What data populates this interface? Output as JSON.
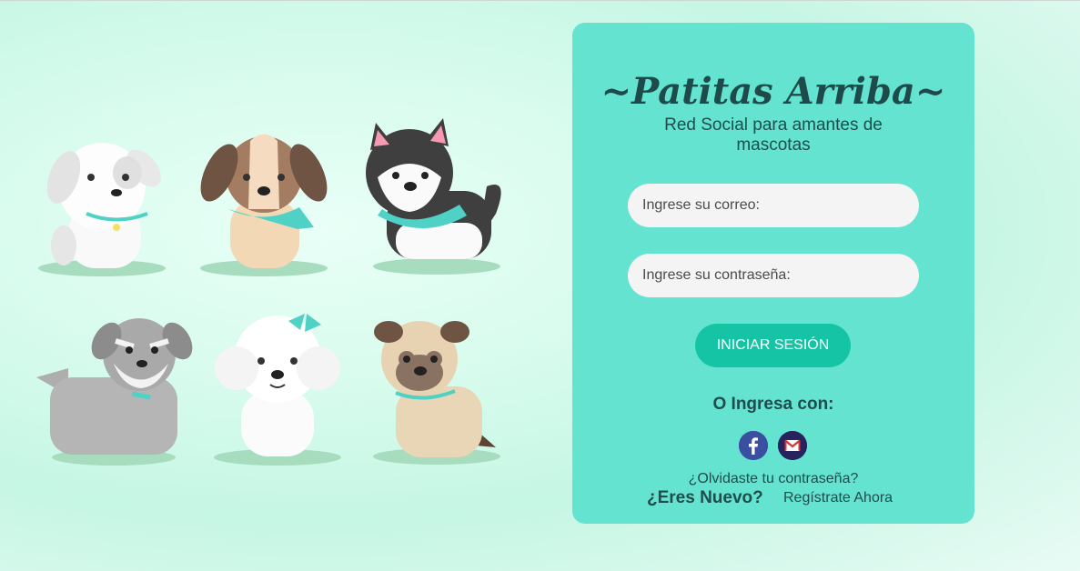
{
  "brand": {
    "title": "~Patitas Arriba~",
    "subtitle": "Red Social para amantes de mascotas"
  },
  "login": {
    "email_placeholder": "Ingrese su correo:",
    "password_placeholder": "Ingrese su contraseña:",
    "submit_label": "INICIAR SESIÓN",
    "or_label": "O Ingresa con:",
    "forgot_label": "¿Olvidaste tu contraseña?",
    "new_label": "¿Eres Nuevo?",
    "register_label": "Regístrate Ahora"
  },
  "social": [
    {
      "icon": "facebook-icon",
      "glyph": "f"
    },
    {
      "icon": "gmail-icon",
      "glyph": "M"
    }
  ],
  "colors": {
    "card": "#64e3d0",
    "button": "#14c4a4",
    "text": "#1f4d4b",
    "scarf": "#4fd1c5"
  },
  "illustration": {
    "dogs": [
      "white-puppy",
      "beagle-puppy",
      "husky-puppy",
      "schnauzer-puppy",
      "poodle-puppy",
      "pug-puppy"
    ]
  }
}
